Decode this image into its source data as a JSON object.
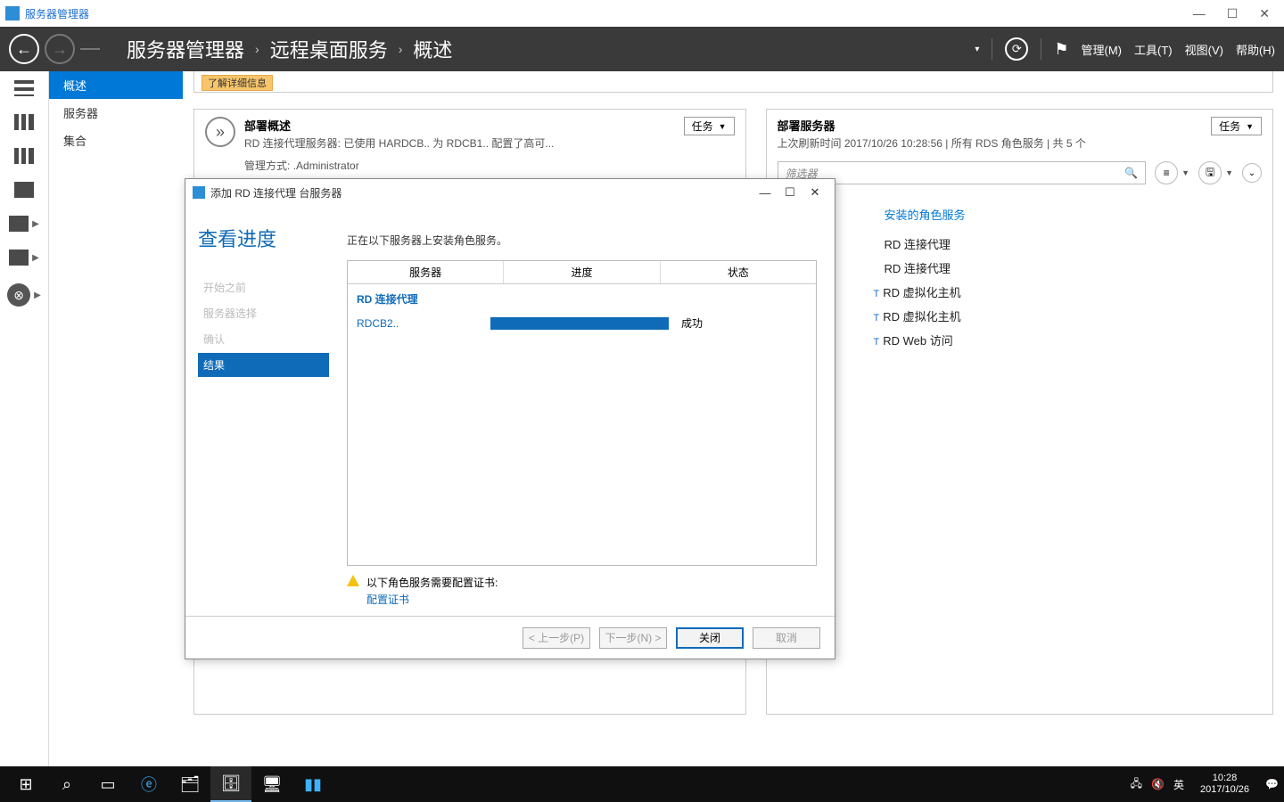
{
  "window": {
    "title": "服务器管理器",
    "min": "—",
    "max": "☐",
    "close": "✕"
  },
  "ribbon": {
    "crumb1": "服务器管理器",
    "crumb2": "远程桌面服务",
    "crumb3": "概述",
    "sep": "›",
    "manage": "管理(M)",
    "tools": "工具(T)",
    "view": "视图(V)",
    "help": "帮助(H)"
  },
  "nav": {
    "items": [
      "概述",
      "服务器",
      "集合"
    ],
    "selected": 0
  },
  "infobar": {
    "learnmore": "了解详细信息"
  },
  "deployOverview": {
    "title": "部署概述",
    "sub": "RD 连接代理服务器: 已使用 HARDCB..            为 RDCB1..            配置了高可...",
    "task": "任务",
    "mgmtLabel": "管理方式:",
    "mgmtUser": ".Administrator"
  },
  "deployServers": {
    "title": "部署服务器",
    "sub": "上次刷新时间 2017/10/26 10:28:56 | 所有 RDS 角色服务  | 共 5 个",
    "task": "任务",
    "filterPlaceholder": "筛选器",
    "rolesHeader": "安装的角色服务",
    "roles": [
      "RD 连接代理",
      "RD 连接代理",
      "RD 虚拟化主机",
      "RD 虚拟化主机",
      "RD Web 访问"
    ]
  },
  "modal": {
    "title": "添加 RD 连接代理 台服务器",
    "heading": "查看进度",
    "steps": [
      "开始之前",
      "服务器选择",
      "确认",
      "结果"
    ],
    "activeStep": 3,
    "msg": "正在以下服务器上安装角色服务。",
    "cols": [
      "服务器",
      "进度",
      "状态"
    ],
    "roleGroup": "RD 连接代理",
    "serverName": "RDCB2..",
    "status": "成功",
    "warnText": "以下角色服务需要配置证书:",
    "warnLink": "配置证书",
    "btnPrev": "< 上一步(P)",
    "btnNext": "下一步(N) >",
    "btnClose": "关闭",
    "btnCancel": "取消"
  },
  "taskbar": {
    "ime": "英",
    "time": "10:28",
    "date": "2017/10/26"
  }
}
